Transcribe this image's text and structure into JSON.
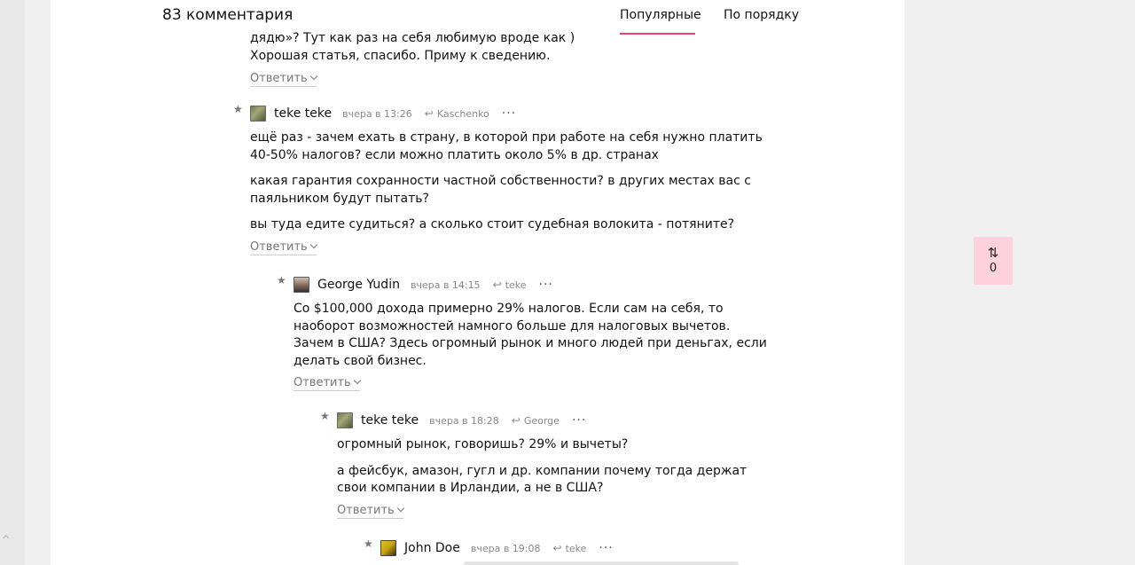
{
  "header": {
    "comment_count": "83 комментария",
    "tab_popular": "Популярные",
    "tab_order": "По порядку"
  },
  "top_fragment": {
    "line1": "дядю»? Тут как раз на себя любимую вроде как )",
    "line2": "Хорошая статья, спасибо. Приму к сведению.",
    "reply": "Ответить"
  },
  "comments": [
    {
      "author": "teke teke",
      "time": "вчера в 13:26",
      "reply_to": "Kaschenko",
      "paragraphs": [
        [
          "ещё раз - зачем ехать в страну, в которой при работе на себя нужно платить",
          "40-50% налогов? если можно платить около 5% в др. странах"
        ],
        [
          "какая гарантия сохранности частной собственности? в других местах вас с",
          "паяльником будут пытать?"
        ],
        [
          "вы туда едите судиться? а сколько стоит судебная волокита - потяните?"
        ]
      ],
      "reply": "Ответить"
    },
    {
      "author": "George Yudin",
      "time": "вчера в 14:15",
      "reply_to": "teke",
      "paragraphs": [
        [
          "Со $100,000 дохода примерно 29% налогов. Если сам на себя, то",
          "наоборот возможностей намного больше для налоговых вычетов.",
          "Зачем в США? Здесь огромный рынок и много людей при деньгах, если",
          "делать свой бизнес."
        ]
      ],
      "reply": "Ответить"
    },
    {
      "author": "teke teke",
      "time": "вчера в 18:28",
      "reply_to": "George",
      "paragraphs": [
        [
          "огромный рынок, говоришь? 29% и вычеты?"
        ],
        [
          "а фейсбук, амазон, гугл и др. компании почему тогда держат",
          "свои компании в Ирландии, а не в США?"
        ]
      ],
      "reply": "Ответить"
    },
    {
      "author": "John Doe",
      "time": "вчера в 19:08",
      "reply_to": "teke"
    }
  ],
  "icons": {
    "star": "star-icon",
    "reply_arrow": "reply-arrow-icon",
    "more": "more-dots-icon",
    "sort": "sort-arrows-icon",
    "scroll_up": "chevron-up-icon"
  },
  "sort_widget": {
    "count": "0"
  },
  "colors": {
    "accent": "#e8456b",
    "sort_widget_bg": "#ffd1dd",
    "meta_text": "#888888"
  }
}
